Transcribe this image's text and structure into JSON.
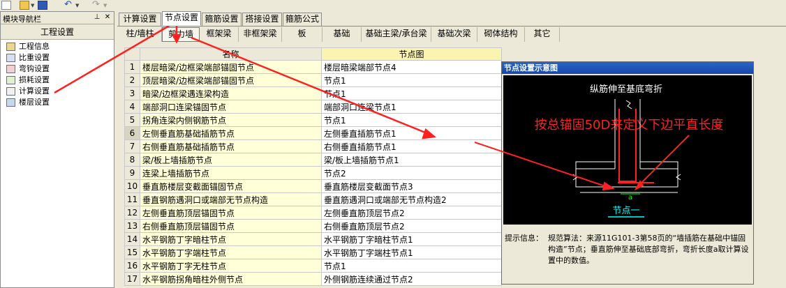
{
  "nav": {
    "title": "模块导航栏",
    "pin_glyph": "⊥",
    "close_glyph": "✕",
    "section": "工程设置",
    "items": [
      {
        "label": "工程信息",
        "icon": "project-info-icon"
      },
      {
        "label": "比重设置",
        "icon": "weight-icon"
      },
      {
        "label": "弯钩设置",
        "icon": "hook-icon"
      },
      {
        "label": "损耗设置",
        "icon": "loss-icon"
      },
      {
        "label": "计算设置",
        "icon": "calc-settings-icon"
      },
      {
        "label": "楼层设置",
        "icon": "floor-icon"
      }
    ]
  },
  "tabs": [
    "计算设置",
    "节点设置",
    "箍筋设置",
    "搭接设置",
    "箍筋公式"
  ],
  "subtabs": [
    "柱/墙柱",
    "剪力墙",
    "框架梁",
    "非框架梁",
    "板",
    "基础",
    "基础主梁/承台梁",
    "基础次梁",
    "砌体结构",
    "其它"
  ],
  "table": {
    "col_name": "名称",
    "col_node": "节点图",
    "rows": [
      {
        "n": "1",
        "name": "楼层暗梁/边框梁端部锚固节点",
        "node": "楼层暗梁端部节点4"
      },
      {
        "n": "2",
        "name": "顶层暗梁/边框梁端部锚固节点",
        "node": "节点1"
      },
      {
        "n": "3",
        "name": "暗梁/边框梁遇连梁构造",
        "node": "节点1"
      },
      {
        "n": "4",
        "name": "端部洞口连梁锚固节点",
        "node": "端部洞口连梁节点1"
      },
      {
        "n": "5",
        "name": "拐角连梁内侧钢筋节点",
        "node": "节点1"
      },
      {
        "n": "6",
        "name": "左侧垂直筋基础插筋节点",
        "node": "左侧垂直插筋节点1"
      },
      {
        "n": "7",
        "name": "右侧垂直筋基础插筋节点",
        "node": "右侧垂直插筋节点1"
      },
      {
        "n": "8",
        "name": "梁/板上墙插筋节点",
        "node": "梁/板上墙插筋节点1"
      },
      {
        "n": "9",
        "name": "连梁上墙插筋节点",
        "node": "节点2"
      },
      {
        "n": "10",
        "name": "垂直筋楼层变截面锚固节点",
        "node": "垂直筋楼层变截面节点3"
      },
      {
        "n": "11",
        "name": "垂直钢筋遇洞口或端部无节点构造",
        "node": "垂直筋遇洞口或端部无节点构造2"
      },
      {
        "n": "12",
        "name": "左侧垂直筋顶层锚固节点",
        "node": "左侧垂直筋顶层节点2"
      },
      {
        "n": "13",
        "name": "右侧垂直筋顶层锚固节点",
        "node": "右侧垂直筋顶层节点2"
      },
      {
        "n": "14",
        "name": "水平钢筋丁字暗柱节点",
        "node": "水平钢筋丁字暗柱节点1"
      },
      {
        "n": "15",
        "name": "水平钢筋丁字端柱节点",
        "node": "水平钢筋丁字端柱节点1"
      },
      {
        "n": "16",
        "name": "水平钢筋丁字无柱节点",
        "node": "节点1"
      },
      {
        "n": "17",
        "name": "水平钢筋拐角暗柱外侧节点",
        "node": "外侧钢筋连续通过节点2"
      }
    ]
  },
  "dialog": {
    "title": "节点设置示意图",
    "caption": "纵筋伸至基底弯折",
    "annotation": "按总锚固50D来定义下边平直长度",
    "dim_label": "a",
    "node_label": "节点一",
    "info_label": "提示信息：",
    "info_text": "规范算法：来源11G101-3第58页的“墙插筋在基础中锚固构造”节点；垂直筋伸至基础底部弯折，弯折长度a取计算设置中的数值。"
  },
  "colors": {
    "annotation_red": "#ff2020",
    "canvas_bg": "#000000",
    "node_label": "#00ffff",
    "header_highlight": "#fbf4b0",
    "name_cell": "#ffffd8"
  },
  "current_row": 6,
  "active_tab": 1,
  "active_subtab": 1
}
